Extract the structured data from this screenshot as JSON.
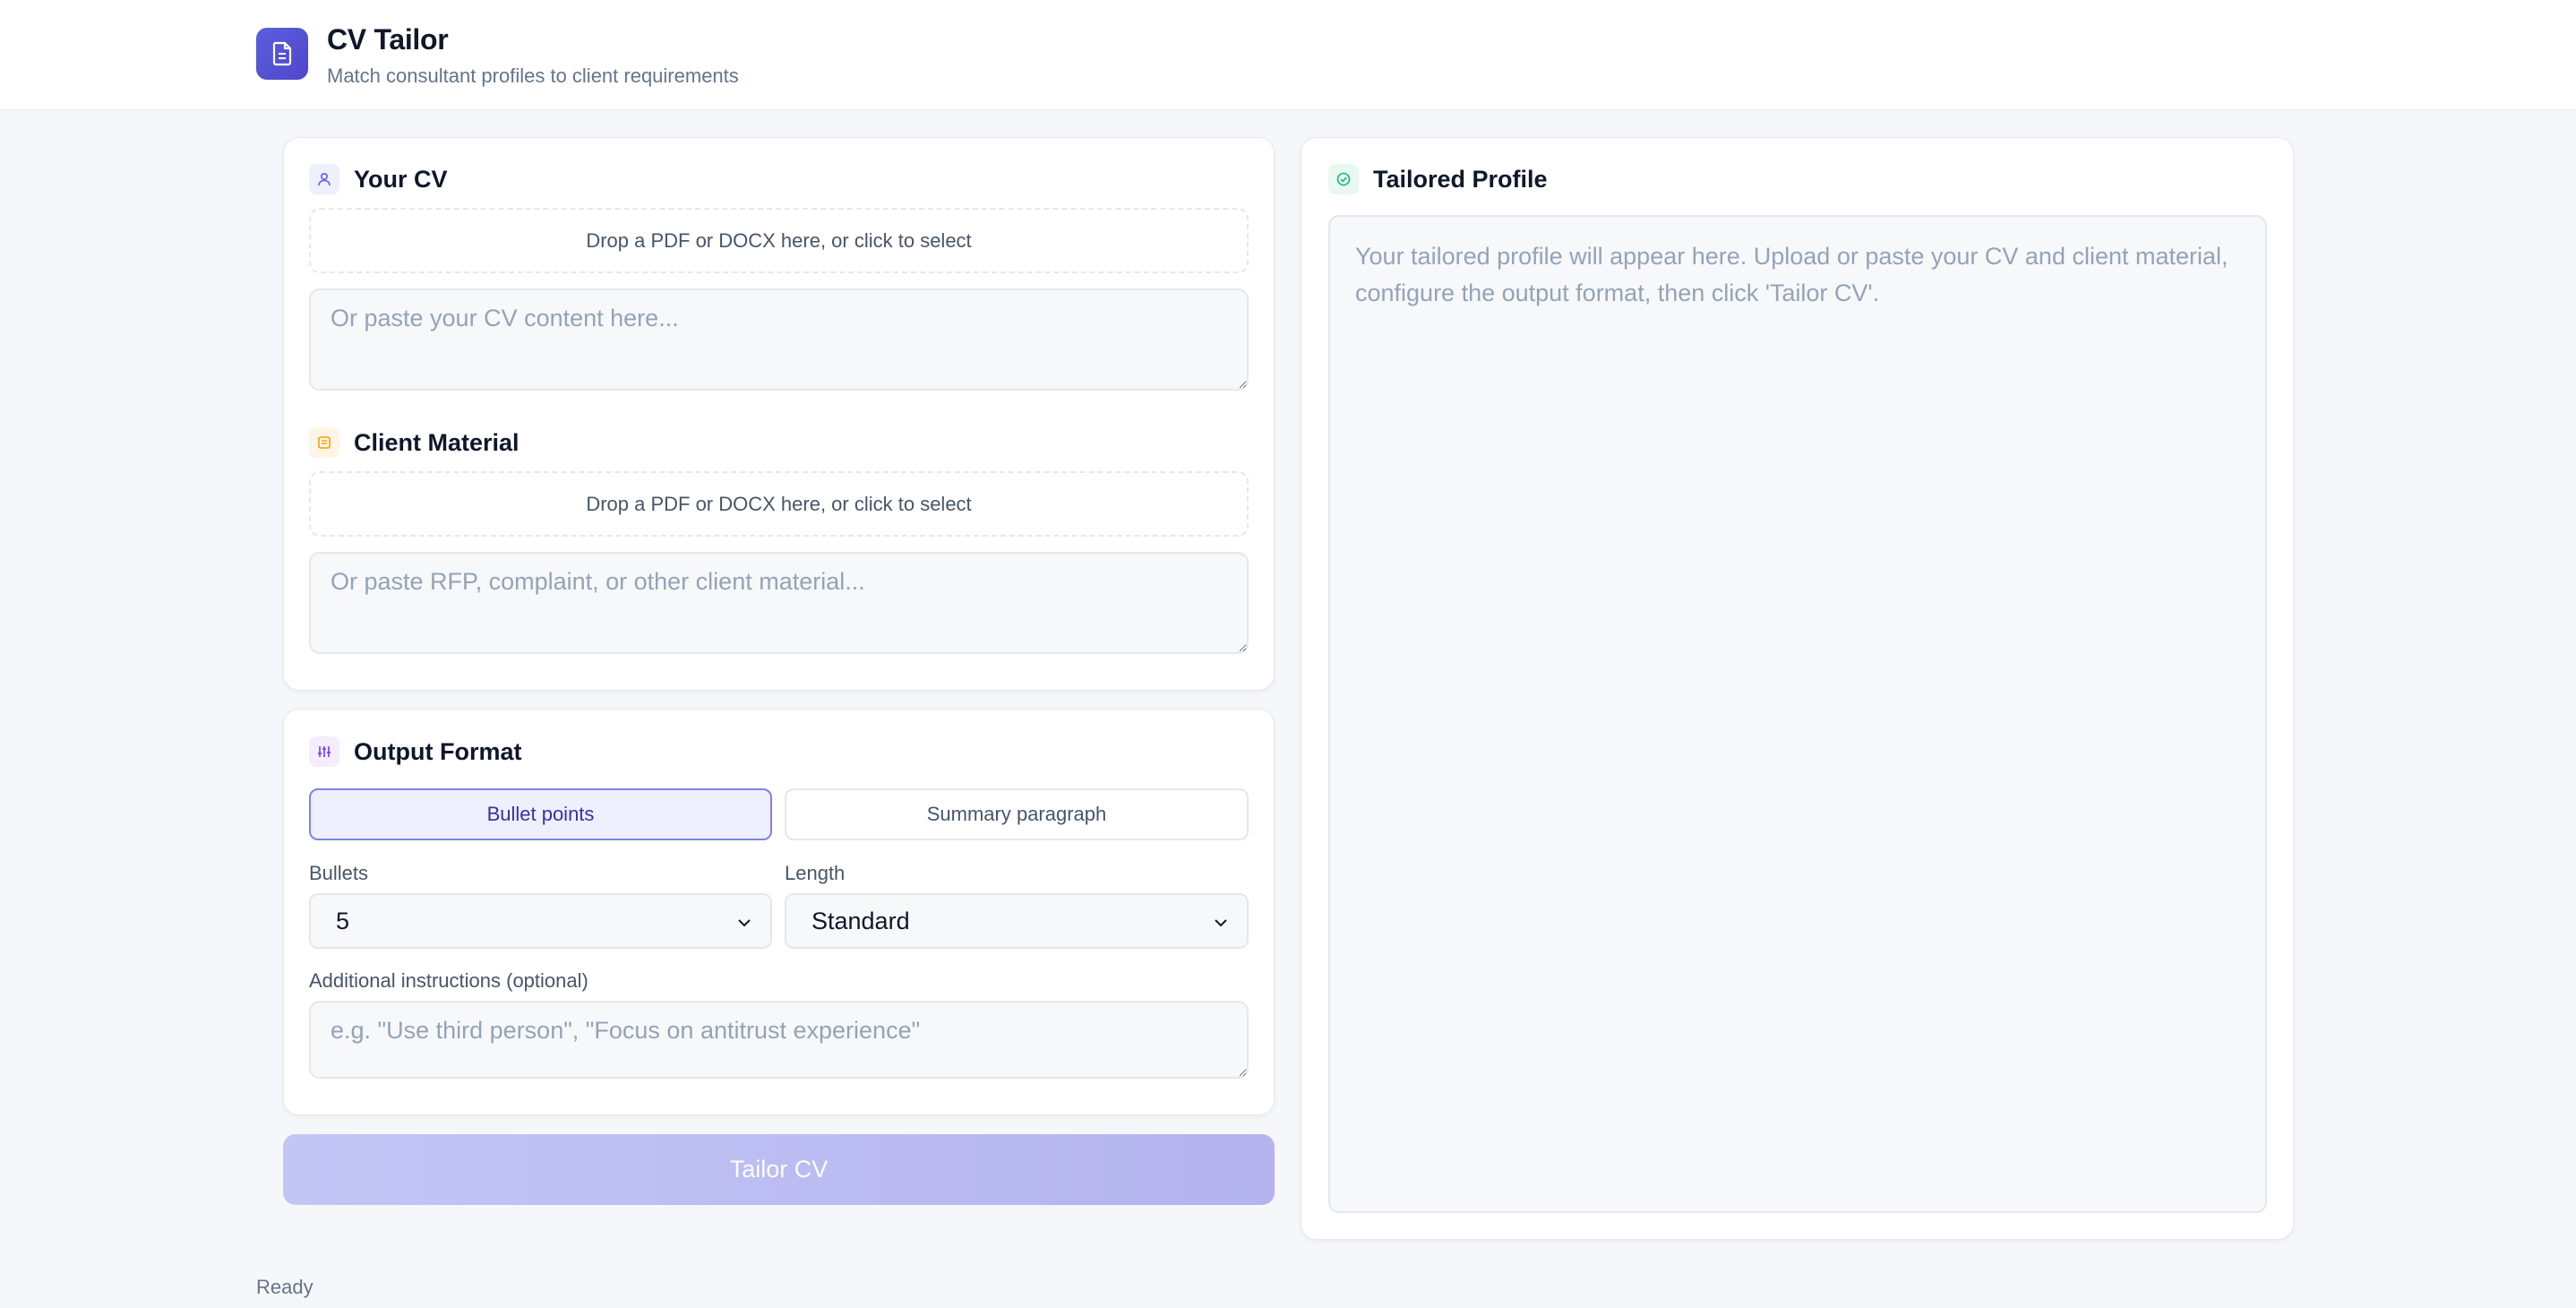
{
  "header": {
    "title": "CV Tailor",
    "subtitle": "Match consultant profiles to client requirements",
    "logo_icon": "document-icon"
  },
  "your_cv": {
    "title": "Your CV",
    "icon": "user-icon",
    "dropzone": "Drop a PDF or DOCX here, or click to select",
    "textarea_placeholder": "Or paste your CV content here...",
    "textarea_value": ""
  },
  "client_material": {
    "title": "Client Material",
    "icon": "file-text-icon",
    "dropzone": "Drop a PDF or DOCX here, or click to select",
    "textarea_placeholder": "Or paste RFP, complaint, or other client material...",
    "textarea_value": ""
  },
  "output_format": {
    "title": "Output Format",
    "icon": "sliders-icon",
    "options": [
      "Bullet points",
      "Summary paragraph"
    ],
    "selected_option": "Bullet points",
    "bullets_label": "Bullets",
    "bullets_value": "5",
    "length_label": "Length",
    "length_value": "Standard",
    "instructions_label": "Additional instructions (optional)",
    "instructions_placeholder": "e.g. \"Use third person\", \"Focus on antitrust experience\""
  },
  "tailor_button": "Tailor CV",
  "tailored_profile": {
    "title": "Tailored Profile",
    "icon": "check-circle-icon",
    "placeholder": "Your tailored profile will appear here. Upload or paste your CV and client material, configure the output format, then click 'Tailor CV'."
  },
  "status": "Ready",
  "colors": {
    "accent": "#4f46c8",
    "accent_light": "#eef0fe",
    "button_disabled": "#c3c6f5",
    "success": "#10b981",
    "warning": "#f59e0b"
  }
}
